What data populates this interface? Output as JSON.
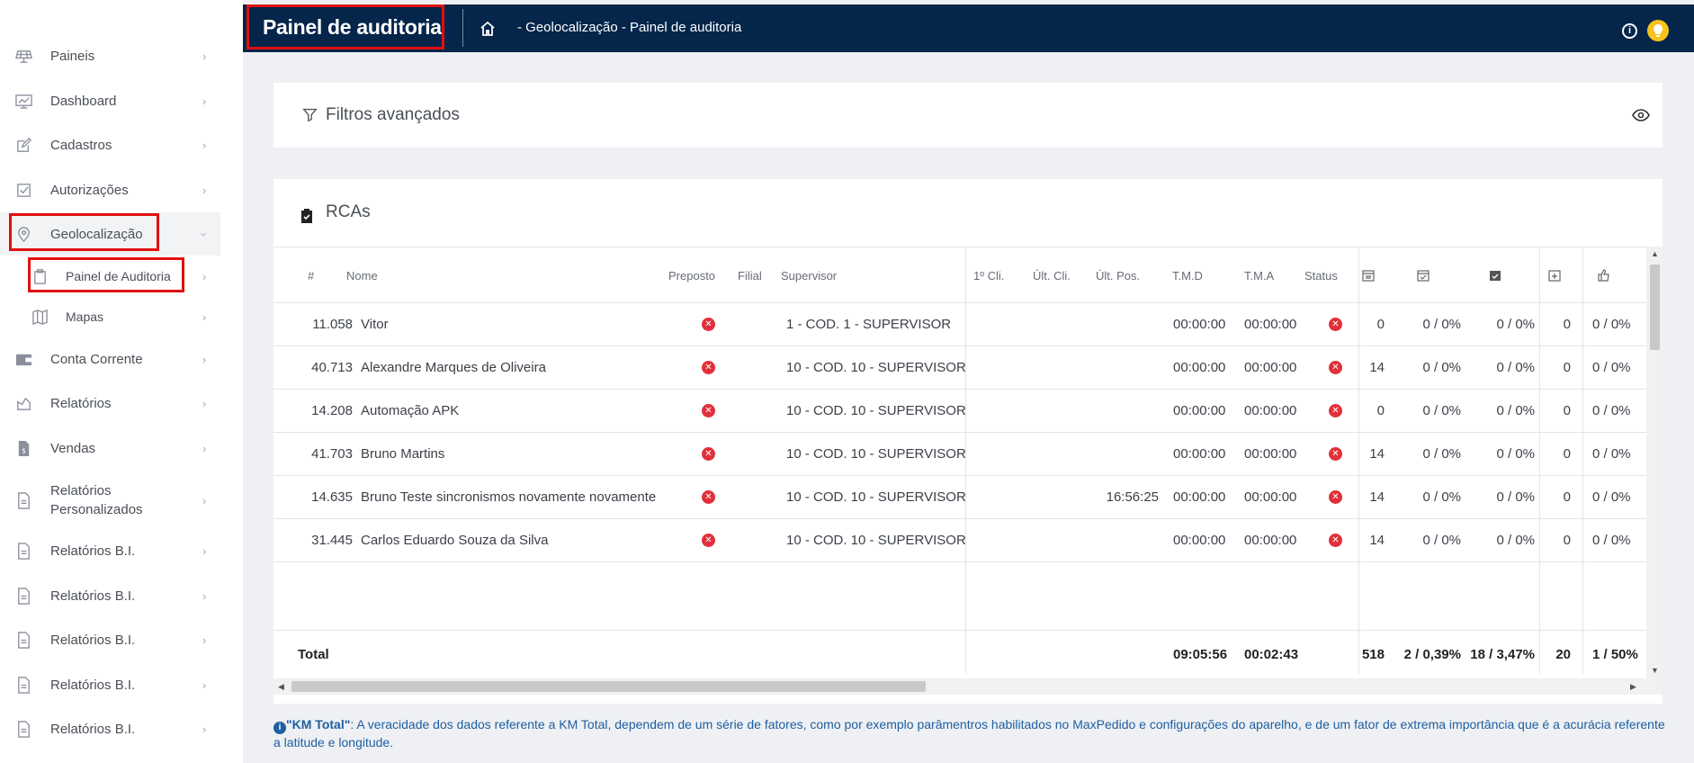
{
  "sidebar": {
    "items": [
      {
        "label": "Paineis",
        "icon": "solar-panel-icon"
      },
      {
        "label": "Dashboard",
        "icon": "chart-icon"
      },
      {
        "label": "Cadastros",
        "icon": "edit-icon"
      },
      {
        "label": "Autorizações",
        "icon": "checkbox-icon"
      },
      {
        "label": "Geolocalização",
        "icon": "location-pin-icon"
      },
      {
        "label": "Painel de Auditoria",
        "icon": "clipboard-icon"
      },
      {
        "label": "Mapas",
        "icon": "map-icon"
      },
      {
        "label": "Conta Corrente",
        "icon": "wallet-icon"
      },
      {
        "label": "Relatórios",
        "icon": "report-icon"
      },
      {
        "label": "Vendas",
        "icon": "sales-document-icon"
      },
      {
        "label": "Relatórios\nPersonalizados",
        "icon": "document-icon"
      },
      {
        "label": "Relatórios B.I.",
        "icon": "document-icon"
      },
      {
        "label": "Relatórios B.I.",
        "icon": "document-icon"
      },
      {
        "label": "Relatórios B.I.",
        "icon": "document-icon"
      },
      {
        "label": "Relatórios B.I.",
        "icon": "document-icon"
      },
      {
        "label": "Relatórios B.I.",
        "icon": "document-icon"
      }
    ]
  },
  "header": {
    "title": "Painel de auditoria",
    "breadcrumb": "- Geolocalização - Painel de auditoria"
  },
  "filters": {
    "title": "Filtros avançados"
  },
  "rcas": {
    "title": "RCAs",
    "columns": [
      "#",
      "Nome",
      "Preposto",
      "Filial",
      "Supervisor",
      "1º Cli.",
      "Últ. Cli.",
      "Últ. Pos.",
      "T.M.D",
      "T.M.A",
      "Status"
    ],
    "rows": [
      {
        "id": "11.058",
        "nome": "Vitor",
        "supervisor": "1 - COD. 1 - SUPERVISOR",
        "ult_pos": "",
        "tmd": "00:00:00",
        "tma": "00:00:00",
        "c1": "0",
        "c2": "0 / 0%",
        "c3": "0 / 0%",
        "c4": "0",
        "c5": "0 / 0%"
      },
      {
        "id": "40.713",
        "nome": "Alexandre Marques de Oliveira",
        "supervisor": "10 - COD. 10 - SUPERVISOR",
        "ult_pos": "",
        "tmd": "00:00:00",
        "tma": "00:00:00",
        "c1": "14",
        "c2": "0 / 0%",
        "c3": "0 / 0%",
        "c4": "0",
        "c5": "0 / 0%"
      },
      {
        "id": "14.208",
        "nome": "Automação APK",
        "supervisor": "10 - COD. 10 - SUPERVISOR",
        "ult_pos": "",
        "tmd": "00:00:00",
        "tma": "00:00:00",
        "c1": "0",
        "c2": "0 / 0%",
        "c3": "0 / 0%",
        "c4": "0",
        "c5": "0 / 0%"
      },
      {
        "id": "41.703",
        "nome": "Bruno Martins",
        "supervisor": "10 - COD. 10 - SUPERVISOR",
        "ult_pos": "",
        "tmd": "00:00:00",
        "tma": "00:00:00",
        "c1": "14",
        "c2": "0 / 0%",
        "c3": "0 / 0%",
        "c4": "0",
        "c5": "0 / 0%"
      },
      {
        "id": "14.635",
        "nome": "Bruno Teste sincronismos novamente novamente",
        "supervisor": "10 - COD. 10 - SUPERVISOR",
        "ult_pos": "16:56:25",
        "tmd": "00:00:00",
        "tma": "00:00:00",
        "c1": "14",
        "c2": "0 / 0%",
        "c3": "0 / 0%",
        "c4": "0",
        "c5": "0 / 0%"
      },
      {
        "id": "31.445",
        "nome": "Carlos Eduardo Souza da Silva",
        "supervisor": "10 - COD. 10 - SUPERVISOR",
        "ult_pos": "",
        "tmd": "00:00:00",
        "tma": "00:00:00",
        "c1": "14",
        "c2": "0 / 0%",
        "c3": "0 / 0%",
        "c4": "0",
        "c5": "0 / 0%"
      }
    ],
    "total": {
      "label": "Total",
      "tmd": "09:05:56",
      "tma": "00:02:43",
      "c1": "518",
      "c2": "2 / 0,39%",
      "c3": "18 / 3,47%",
      "c4": "20",
      "c5": "1 / 50%"
    }
  },
  "footnote": {
    "lead": "\"KM Total\"",
    "text": ": A veracidade dos dados referente a KM Total, dependem de um série de fatores, como por exemplo parâmentros habilitados no MaxPedido e configurações do aparelho, e de um fator de extrema importância que é a acurácia referente a latitude e longitude."
  },
  "colors": {
    "topbar": "#05254a",
    "error": "#e0313a",
    "highlight": "#e01010",
    "footnote": "#1e5fa0",
    "avatar": "#f6c21b"
  }
}
